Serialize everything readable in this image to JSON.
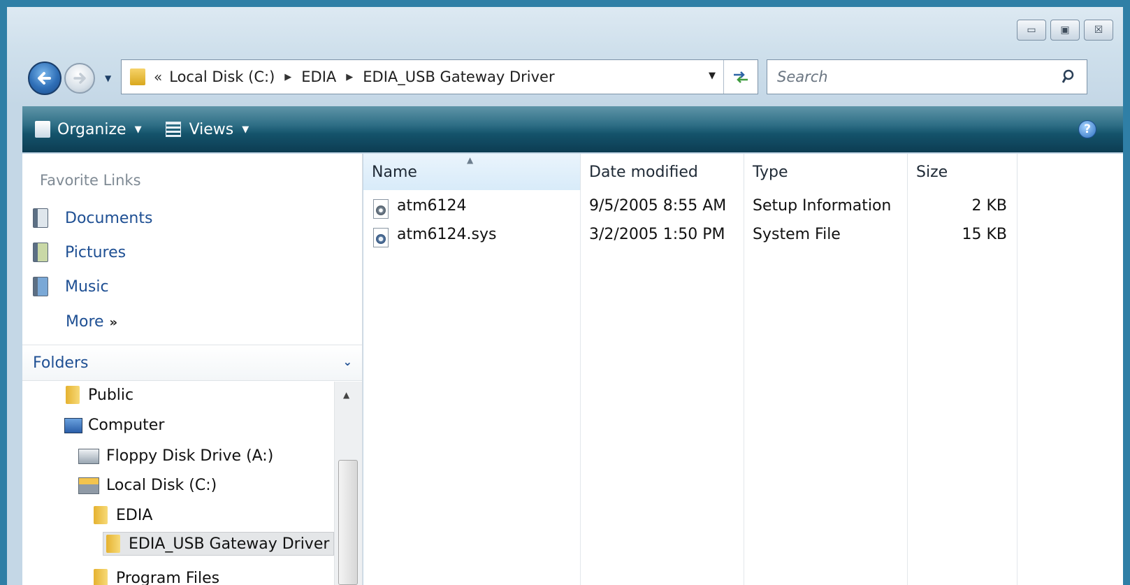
{
  "window": {
    "controls": [
      {
        "name": "minimize",
        "glyph": "▭"
      },
      {
        "name": "maximize",
        "glyph": "▣"
      },
      {
        "name": "close",
        "glyph": "☒"
      }
    ]
  },
  "address": {
    "overflow": "«",
    "crumbs": [
      "Local Disk (C:)",
      "EDIA",
      "EDIA_USB Gateway Driver"
    ]
  },
  "search": {
    "placeholder": "Search"
  },
  "toolbar": {
    "organize_label": "Organize",
    "views_label": "Views",
    "help_label": "?"
  },
  "nav": {
    "favorites_title": "Favorite Links",
    "links": [
      "Documents",
      "Pictures",
      "Music"
    ],
    "more_label": "More",
    "more_glyph": "»",
    "folders_title": "Folders",
    "tree": [
      "Public",
      "Computer",
      "Floppy Disk Drive (A:)",
      "Local Disk (C:)",
      "EDIA",
      "EDIA_USB Gateway Driver",
      "Program Files"
    ]
  },
  "files": {
    "columns": [
      "Name",
      "Date modified",
      "Type",
      "Size"
    ],
    "sorted_column": "Name",
    "rows": [
      {
        "name": "atm6124",
        "date": "9/5/2005 8:55 AM",
        "type": "Setup Information",
        "size": "2 KB",
        "icon": "setup-information-icon"
      },
      {
        "name": "atm6124.sys",
        "date": "3/2/2005 1:50 PM",
        "type": "System File",
        "size": "15 KB",
        "icon": "system-file-icon"
      }
    ]
  },
  "colors": {
    "command_bar": "#14536b",
    "link_text": "#1e4f93",
    "selection": "#e4e6e8"
  }
}
